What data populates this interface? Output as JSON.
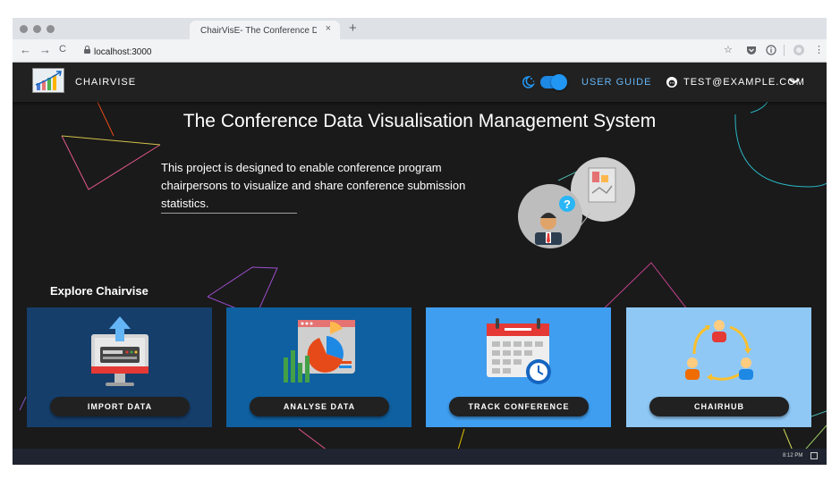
{
  "browser": {
    "tab_title": "ChairVisE- The Conference Data V...",
    "tab_close": "×",
    "new_tab": "+",
    "url": "localhost:3000",
    "back": "←",
    "forward": "→",
    "reload": "C",
    "bookmark": "☆"
  },
  "header": {
    "brand": "CHAIRVISE",
    "user_guide": "USER GUIDE",
    "user_email": "TEST@EXAMPLE.COM",
    "dropdown": "❯"
  },
  "hero": {
    "title": "The Conference Data Visualisation Management System",
    "description": "This project is designed to enable conference program chairpersons to visualize and share conference submission statistics."
  },
  "explore": {
    "heading": "Explore Chairvise",
    "cards": [
      {
        "label": "IMPORT DATA",
        "bg": "#153e6b",
        "icon": "computer-upload-icon"
      },
      {
        "label": "ANALYSE DATA",
        "bg": "#0f60a0",
        "icon": "analytics-chart-icon"
      },
      {
        "label": "TRACK CONFERENCE",
        "bg": "#3f9ef0",
        "icon": "calendar-clock-icon"
      },
      {
        "label": "CHAIRHUB",
        "bg": "#8fc8f5",
        "icon": "collaboration-cycle-icon"
      }
    ]
  },
  "taskbar": {
    "clock": "8:12 PM"
  },
  "colors": {
    "app_bar": "#212121",
    "background": "#1a1a1a",
    "accent": "#2196f3"
  }
}
